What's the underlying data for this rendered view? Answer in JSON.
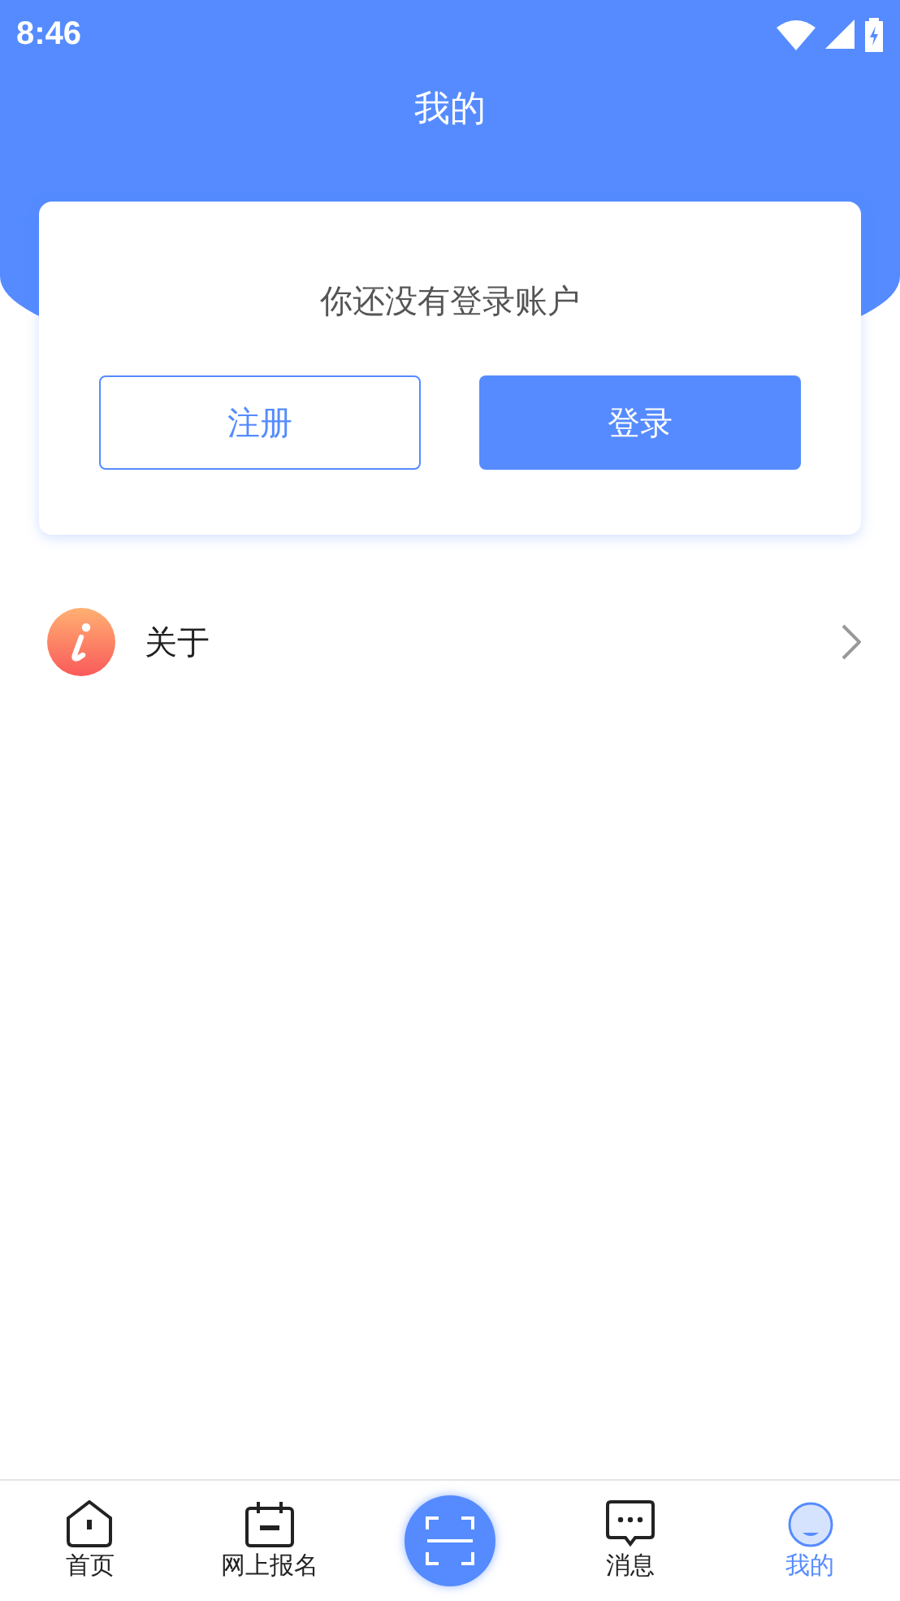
{
  "status_bar": {
    "time": "8:46"
  },
  "header": {
    "title": "我的"
  },
  "login_card": {
    "message": "你还没有登录账户",
    "buttons": [
      {
        "label": "注册",
        "kind": "outline"
      },
      {
        "label": "登录",
        "kind": "filled"
      }
    ]
  },
  "menu": [
    {
      "label": "关于"
    }
  ],
  "bottom_nav": [
    {
      "label": "首页",
      "kind": "home",
      "selected": false
    },
    {
      "label": "网上报名",
      "kind": "calendar",
      "selected": false
    },
    {
      "kind": "scan",
      "selected": false
    },
    {
      "label": "消息",
      "kind": "message",
      "selected": false
    },
    {
      "label": "我的",
      "kind": "profile",
      "selected": true
    }
  ]
}
